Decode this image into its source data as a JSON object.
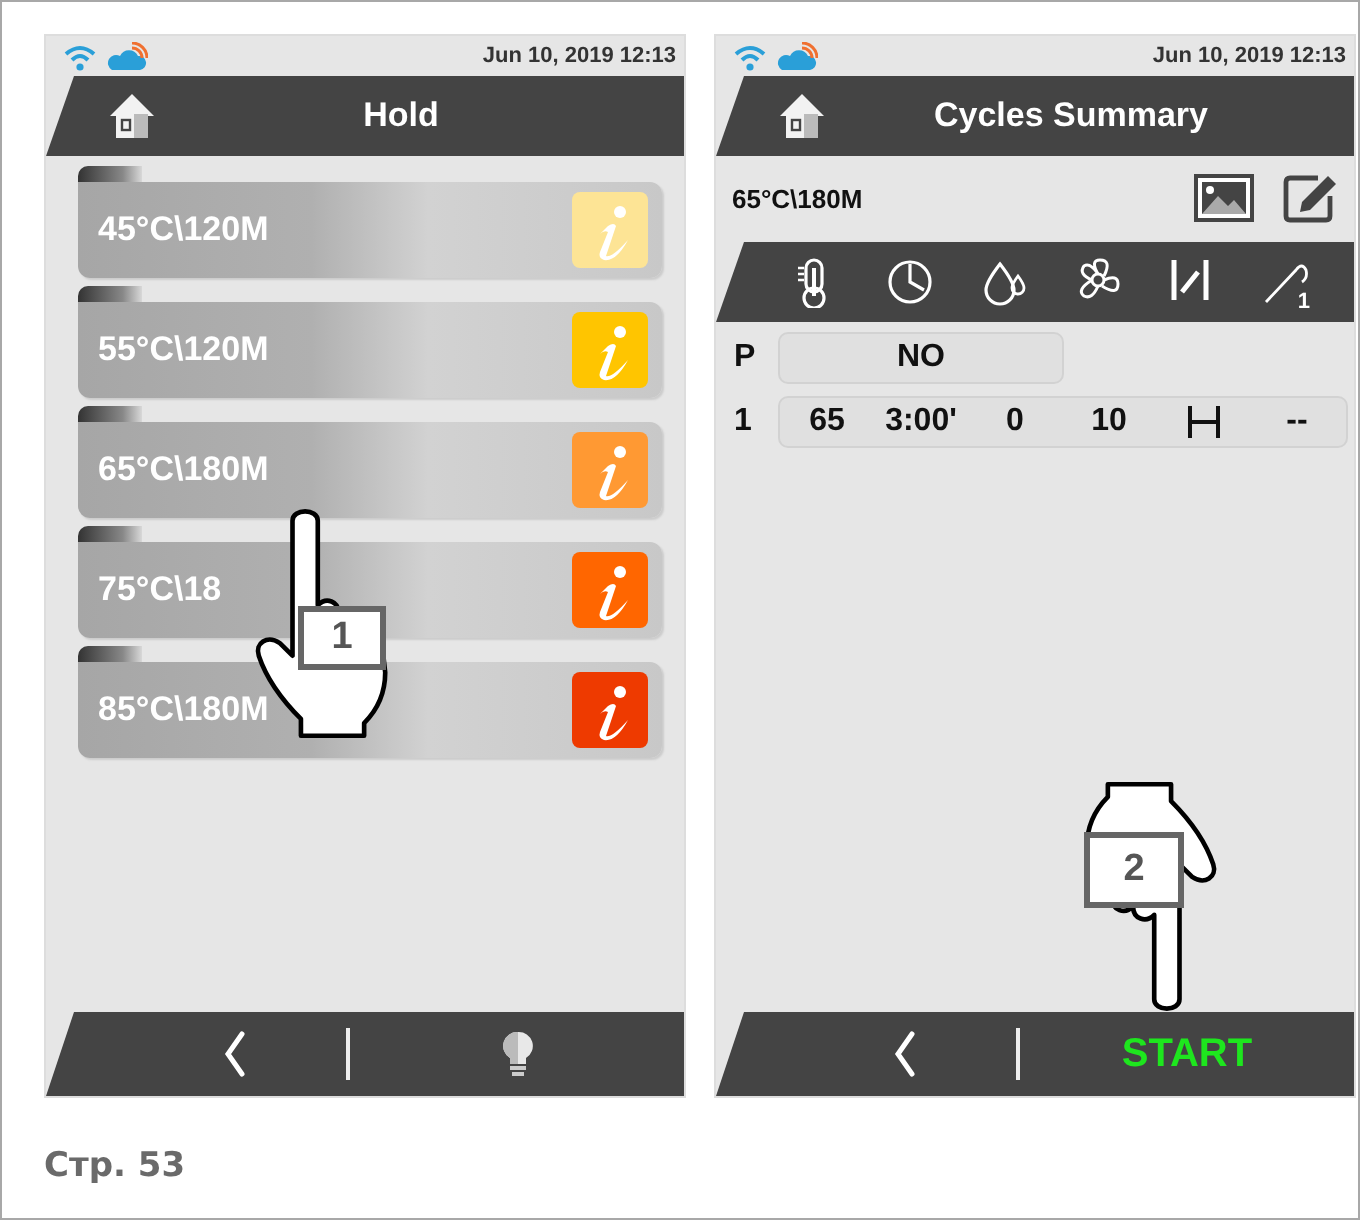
{
  "screens": [
    {
      "kind": "list",
      "datetime": "Jun 10, 2019 12:13",
      "title": "Hold",
      "items": [
        {
          "label": "45°C\\120M",
          "color": "#fde495"
        },
        {
          "label": "55°C\\120M",
          "color": "#ffc500"
        },
        {
          "label": "65°C\\180M",
          "color": "#ff9933"
        },
        {
          "label": "75°C\\18",
          "color": "#ff6600"
        },
        {
          "label": "85°C\\180M",
          "color": "#ee3a00"
        }
      ],
      "action": {
        "kind": "bulb"
      },
      "callout": {
        "number": "1"
      }
    },
    {
      "kind": "summary",
      "datetime": "Jun 10, 2019 12:13",
      "title": "Cycles Summary",
      "recipe": "65°C\\180M",
      "probe_number": "1",
      "preheat": {
        "label": "P",
        "value": "NO"
      },
      "rows": [
        {
          "kind": "step",
          "label": "1",
          "cells": [
            {
              "kind": "text",
              "text": "65"
            },
            {
              "kind": "text",
              "text": "3:00'"
            },
            {
              "kind": "text",
              "text": "0"
            },
            {
              "kind": "text",
              "text": "10"
            },
            {
              "kind": "hold-icon"
            },
            {
              "kind": "text",
              "text": "--"
            }
          ]
        }
      ],
      "action": {
        "kind": "text",
        "label": "START"
      },
      "callout": {
        "number": "2"
      }
    }
  ],
  "page_label": "Стр. 53"
}
